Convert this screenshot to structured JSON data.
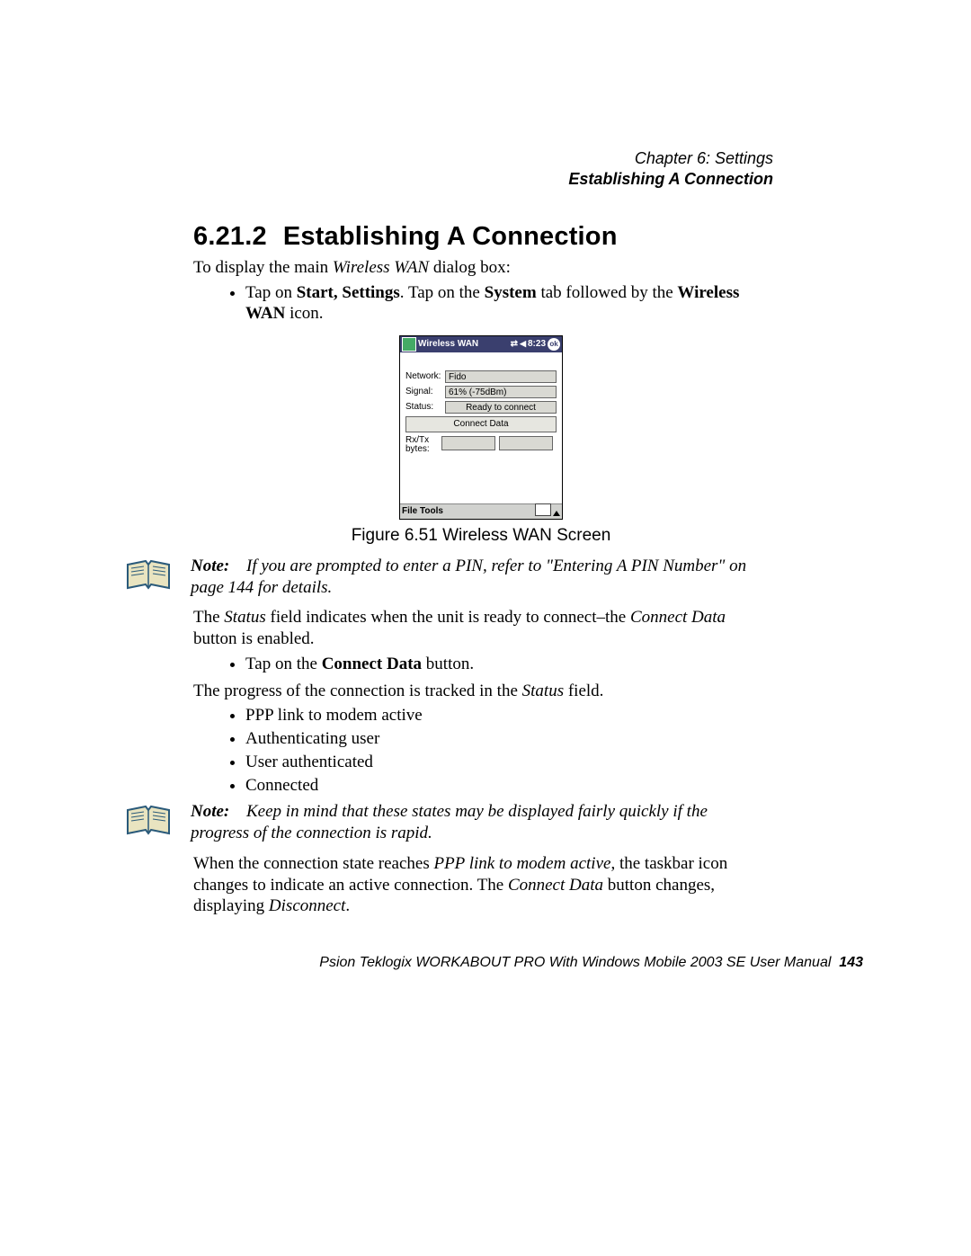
{
  "header": {
    "chapter": "Chapter 6:  Settings",
    "section": "Establishing A Connection"
  },
  "heading": {
    "number": "6.21.2",
    "title": "Establishing A Connection"
  },
  "intro_line_pre": "To display the main ",
  "intro_line_italic": "Wireless WAN",
  "intro_line_post": " dialog box:",
  "bullet1_a": "Tap on ",
  "bullet1_b": "Start, Settings",
  "bullet1_c": ". Tap on the ",
  "bullet1_d": "System",
  "bullet1_e": " tab followed by the ",
  "bullet1_f": "Wireless WAN",
  "bullet1_g": " icon.",
  "device": {
    "title": "Wireless WAN",
    "time": "8:23",
    "ok": "ok",
    "labels": {
      "network": "Network:",
      "signal": "Signal:",
      "status": "Status:",
      "rxtx": "Rx/Tx bytes:"
    },
    "values": {
      "network": "Fido",
      "signal": "61% (-75dBm)",
      "status": "Ready to connect"
    },
    "connect_button": "Connect Data",
    "menubar": "File  Tools"
  },
  "figure_caption": "Figure 6.51 Wireless WAN Screen",
  "note1": {
    "label": "Note:",
    "text": "If you are prompted to enter a PIN, refer to \"Entering A PIN Number\" on page 144 for details."
  },
  "para2_a": "The ",
  "para2_b": "Status",
  "para2_c": " field indicates when the unit is ready to connect–the ",
  "para2_d": "Connect Data",
  "para2_e": " button is enabled.",
  "bullet2": "Tap on the ",
  "bullet2_bold": "Connect Data",
  "bullet2_post": " button.",
  "para3_a": "The progress of the connection is tracked in the ",
  "para3_b": "Status",
  "para3_c": " field.",
  "states": [
    "PPP link to modem active",
    "Authenticating user",
    "User authenticated",
    "Connected"
  ],
  "note2": {
    "label": "Note:",
    "text": "Keep in mind that these states may be displayed fairly quickly if the progress of the connection is rapid."
  },
  "para4_a": "When the connection state reaches ",
  "para4_b": "PPP link to modem active",
  "para4_c": ", the taskbar icon changes to indicate an active connection. The ",
  "para4_d": "Connect Data",
  "para4_e": " button changes, displaying ",
  "para4_f": "Disconnect",
  "para4_g": ".",
  "footer": {
    "text": "Psion Teklogix WORKABOUT PRO With Windows Mobile 2003 SE User Manual",
    "page": "143"
  }
}
